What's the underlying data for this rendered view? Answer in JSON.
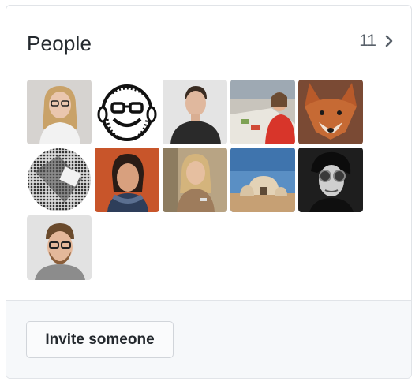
{
  "people_card": {
    "title": "People",
    "count": "11",
    "count_icon": "chevron-right-icon",
    "members": [
      {
        "name": "member-avatar-1"
      },
      {
        "name": "member-avatar-2"
      },
      {
        "name": "member-avatar-3"
      },
      {
        "name": "member-avatar-4"
      },
      {
        "name": "member-avatar-5"
      },
      {
        "name": "member-avatar-6"
      },
      {
        "name": "member-avatar-7"
      },
      {
        "name": "member-avatar-8"
      },
      {
        "name": "member-avatar-9"
      },
      {
        "name": "member-avatar-10"
      },
      {
        "name": "member-avatar-11"
      }
    ],
    "invite_label": "Invite someone"
  },
  "colors": {
    "border": "#e1e4e8",
    "footer_bg": "#f6f8fa",
    "text": "#24292e",
    "muted": "#586069"
  }
}
